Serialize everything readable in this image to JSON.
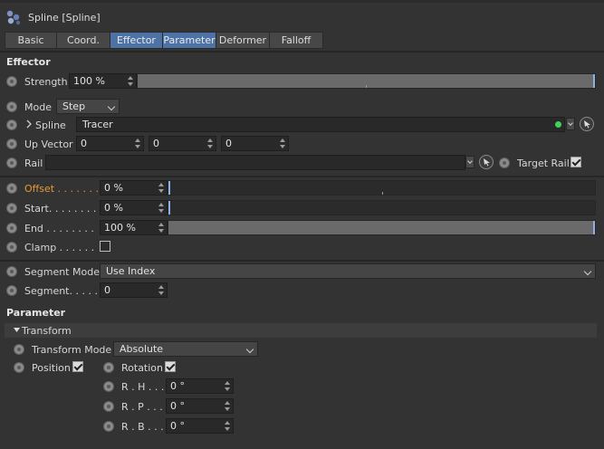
{
  "window": {
    "title": "Spline [Spline]"
  },
  "tabs": [
    {
      "label": "Basic"
    },
    {
      "label": "Coord."
    },
    {
      "label": "Effector"
    },
    {
      "label": "Parameter"
    },
    {
      "label": "Deformer"
    },
    {
      "label": "Falloff"
    }
  ],
  "effector": {
    "section_title": "Effector",
    "strength": {
      "label": "Strength",
      "value": "100 %",
      "level": 1.0
    },
    "mode": {
      "label": "Mode",
      "value": "Step"
    },
    "spline": {
      "label": "Spline",
      "value": "Tracer"
    },
    "up_vector": {
      "label": "Up Vector",
      "x": "0",
      "y": "0",
      "z": "0"
    },
    "rail": {
      "label": "Rail",
      "value": "",
      "target_rail_label": "Target Rail",
      "target_rail_checked": true
    },
    "offset": {
      "label": "Offset . . . . . . .",
      "value": "0 %",
      "level": 0.0
    },
    "start": {
      "label": "Start. . . . . . . .",
      "value": "0 %",
      "level": 0.0
    },
    "end": {
      "label": "End . . . . . . . .",
      "value": "100 %",
      "level": 1.0
    },
    "clamp": {
      "label": "Clamp . . . . . .",
      "checked": false
    },
    "segment_mode": {
      "label": "Segment Mode",
      "value": "Use Index"
    },
    "segment": {
      "label": "Segment. . . . .",
      "value": "0"
    }
  },
  "parameter": {
    "section_title": "Parameter",
    "transform_group": "Transform",
    "transform_mode": {
      "label": "Transform Mode",
      "value": "Absolute"
    },
    "position": {
      "label": "Position",
      "checked": true
    },
    "rotation": {
      "label": "Rotation",
      "checked": true
    },
    "rh": {
      "label": "R . H . . .",
      "value": "0 °"
    },
    "rp": {
      "label": "R . P . . .",
      "value": "0 °"
    },
    "rb": {
      "label": "R . B . . .",
      "value": "0 °"
    }
  },
  "colors": {
    "accent": "#4d73a6",
    "highlight_label": "#e59a3a",
    "slider_marker": "#8eb1e3"
  }
}
